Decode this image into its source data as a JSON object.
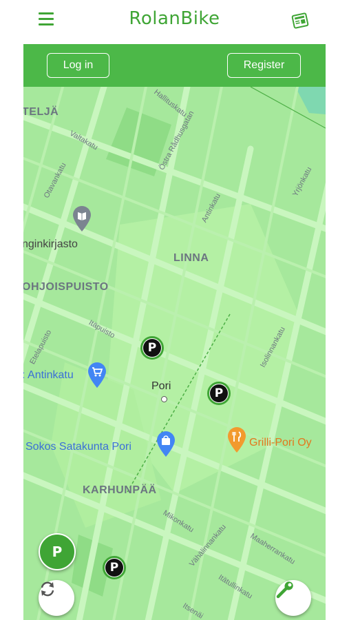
{
  "header": {
    "app_title": "RolanBike",
    "menu_icon": "hamburger-menu-icon",
    "news_icon": "newspaper-icon",
    "brand_color": "#3fa535"
  },
  "auth_bar": {
    "login_label": "Log in",
    "register_label": "Register",
    "bar_color": "#4cb848"
  },
  "map": {
    "districts": [
      "TELJÄ",
      "LINNA",
      "OHJOISPUISTO",
      "KARHUNPÄÄ"
    ],
    "streets": [
      "Hallituskatu",
      "Valtakatu",
      "Östra Rådhusgatan",
      "Otavankatu",
      "Antinkatu",
      "Yrjönkatu",
      "Itäpuisto",
      "Etelapuisto",
      "Isolinnankatu",
      "Mikonkatu",
      "Vähälinnankatu",
      "Maaherrankatu",
      "Itätullinkatu",
      "Itsenäi"
    ],
    "places": {
      "library": "nginkirjasto",
      "antinkatu_shop": "Antinkatu",
      "city": "Pori",
      "sokos": "Sokos Satakunta Pori",
      "grilli": "Grilli-Pori Oy"
    },
    "place_icons": {
      "library": "book-pin-icon",
      "antinkatu_shop": "shopping-cart-pin-icon",
      "sokos": "shopping-bag-pin-icon",
      "grilli": "restaurant-pin-icon"
    },
    "parking_marker_label": "P",
    "parking_marker_count": 3
  },
  "controls": {
    "parking_fab_label": "P",
    "refresh_icon": "refresh-icon",
    "tools_icon": "wrench-icon"
  }
}
